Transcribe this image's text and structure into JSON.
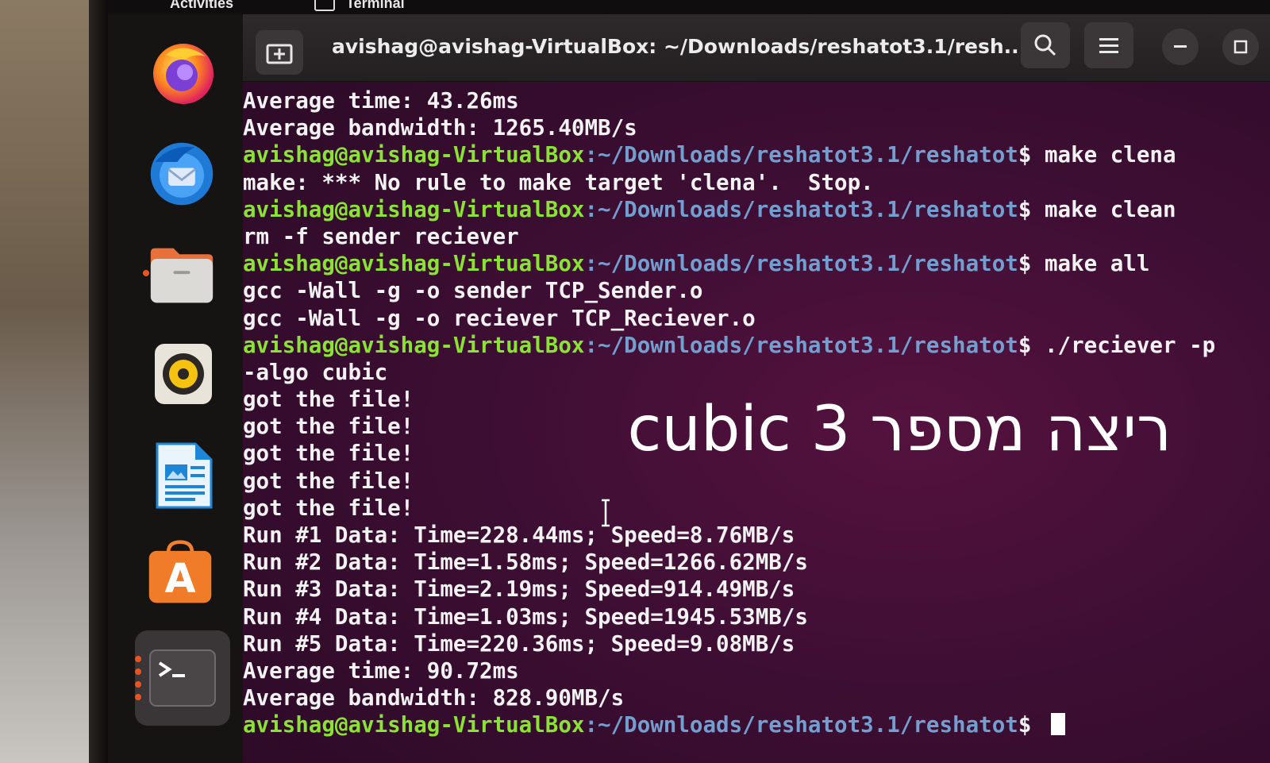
{
  "topbar": {
    "activities": "Activities",
    "app_name": "Terminal"
  },
  "dock": {
    "items": [
      {
        "name": "firefox",
        "icon": "firefox-icon"
      },
      {
        "name": "thunderbird",
        "icon": "thunderbird-icon"
      },
      {
        "name": "files",
        "icon": "files-icon",
        "running": true
      },
      {
        "name": "rhythmbox",
        "icon": "rhythmbox-icon"
      },
      {
        "name": "writer",
        "icon": "libreoffice-writer-icon"
      },
      {
        "name": "software",
        "icon": "app-center-icon",
        "glyph": "A"
      },
      {
        "name": "terminal",
        "icon": "terminal-icon",
        "glyph": ">_",
        "running": true,
        "active": true
      }
    ]
  },
  "window": {
    "title": "avishag@avishag-VirtualBox: ~/Downloads/reshatot3.1/resh...",
    "new_tab_icon": "new-tab-icon",
    "search_icon": "search-icon",
    "menu_icon": "hamburger-menu-icon",
    "minimize_icon": "minimize-icon",
    "maximize_icon": "maximize-icon"
  },
  "terminal": {
    "prompt_user": "avishag@avishag-VirtualBox",
    "prompt_path": ":~/Downloads/reshatot3.1/reshatot",
    "prompt_symbol": "$",
    "lines": [
      {
        "type": "out",
        "text": "Average time: 43.26ms"
      },
      {
        "type": "out",
        "text": "Average bandwidth: 1265.40MB/s"
      },
      {
        "type": "cmd",
        "cmd": " make clena"
      },
      {
        "type": "out",
        "text": "make: *** No rule to make target 'clena'.  Stop."
      },
      {
        "type": "cmd",
        "cmd": " make clean"
      },
      {
        "type": "out",
        "text": "rm -f sender reciever"
      },
      {
        "type": "cmd",
        "cmd": " make all"
      },
      {
        "type": "out",
        "text": "gcc -Wall -g -o sender TCP_Sender.o"
      },
      {
        "type": "out",
        "text": "gcc -Wall -g -o reciever TCP_Reciever.o"
      },
      {
        "type": "cmd",
        "cmd": " ./reciever -p"
      },
      {
        "type": "out",
        "text": "-algo cubic"
      },
      {
        "type": "out",
        "text": "got the file!"
      },
      {
        "type": "out",
        "text": "got the file!"
      },
      {
        "type": "out",
        "text": "got the file!"
      },
      {
        "type": "out",
        "text": "got the file!"
      },
      {
        "type": "out",
        "text": "got the file!"
      },
      {
        "type": "out",
        "text": "Run #1 Data: Time=228.44ms; Speed=8.76MB/s"
      },
      {
        "type": "out",
        "text": "Run #2 Data: Time=1.58ms; Speed=1266.62MB/s"
      },
      {
        "type": "out",
        "text": "Run #3 Data: Time=2.19ms; Speed=914.49MB/s"
      },
      {
        "type": "out",
        "text": "Run #4 Data: Time=1.03ms; Speed=1945.53MB/s"
      },
      {
        "type": "out",
        "text": "Run #5 Data: Time=220.36ms; Speed=9.08MB/s"
      },
      {
        "type": "out",
        "text": "Average time: 90.72ms"
      },
      {
        "type": "out",
        "text": "Average bandwidth: 828.90MB/s"
      },
      {
        "type": "cmd",
        "cmd": " ",
        "cursor": true
      }
    ]
  },
  "overlay": {
    "text": "ריצה מספר 3 cubic"
  }
}
